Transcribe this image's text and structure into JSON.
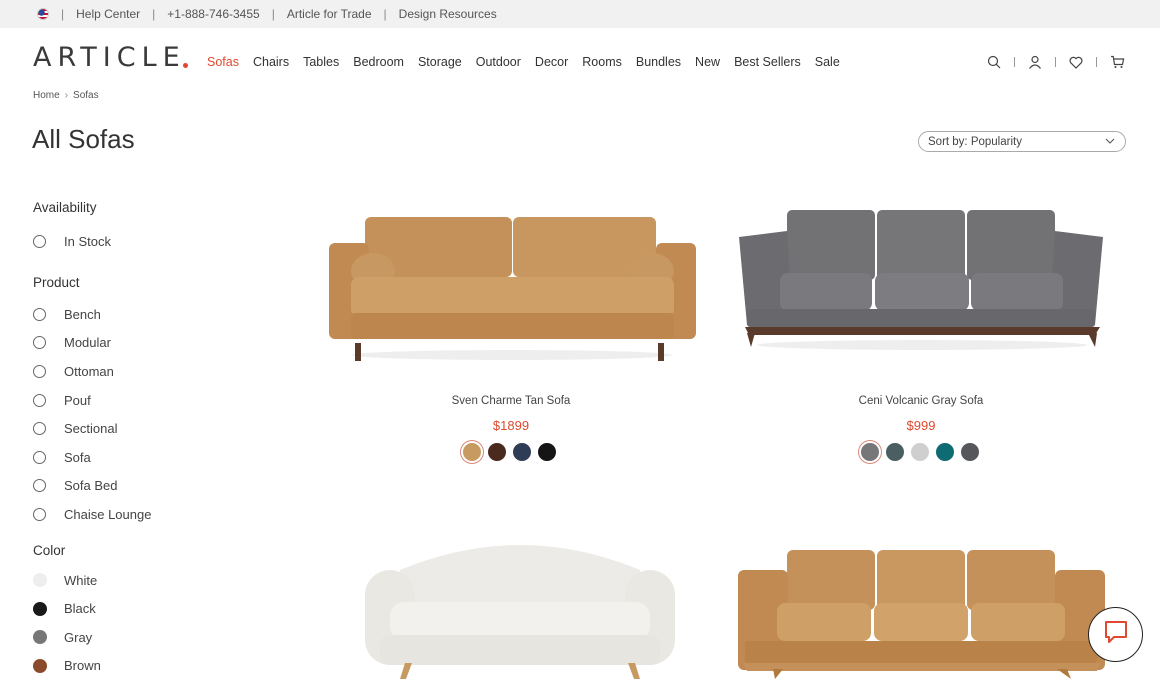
{
  "topbar": {
    "help": "Help Center",
    "phone": "+1-888-746-3455",
    "trade": "Article for Trade",
    "design": "Design Resources"
  },
  "header": {
    "logo": "ARTICLE",
    "nav": [
      "Sofas",
      "Chairs",
      "Tables",
      "Bedroom",
      "Storage",
      "Outdoor",
      "Decor",
      "Rooms",
      "Bundles",
      "New",
      "Best Sellers",
      "Sale"
    ],
    "active_nav": "Sofas",
    "icons": [
      "search-icon",
      "account-icon",
      "heart-icon",
      "cart-icon"
    ]
  },
  "breadcrumb": {
    "home": "Home",
    "current": "Sofas"
  },
  "page_title": "All Sofas",
  "sort": {
    "label": "Sort by: Popularity"
  },
  "filters": {
    "availability": {
      "title": "Availability",
      "options": [
        "In Stock"
      ]
    },
    "product": {
      "title": "Product",
      "options": [
        "Bench",
        "Modular",
        "Ottoman",
        "Pouf",
        "Sectional",
        "Sofa",
        "Sofa Bed",
        "Chaise Lounge"
      ]
    },
    "color": {
      "title": "Color",
      "options": [
        {
          "label": "White",
          "color": "#eeeeee"
        },
        {
          "label": "Black",
          "color": "#1a1a1a"
        },
        {
          "label": "Gray",
          "color": "#777777"
        },
        {
          "label": "Brown",
          "color": "#8b4a2b"
        }
      ]
    }
  },
  "products": [
    {
      "name": "Sven Charme Tan Sofa",
      "price": "$1899",
      "swatches": [
        "#c79a62",
        "#4a2a1f",
        "#2e3d55",
        "#151515"
      ]
    },
    {
      "name": "Ceni Volcanic Gray Sofa",
      "price": "$999",
      "swatches": [
        "#77777a",
        "#4b5f63",
        "#cfcfcf",
        "#0f6b73",
        "#55575a"
      ]
    }
  ],
  "colors": {
    "accent": "#e0492f"
  }
}
